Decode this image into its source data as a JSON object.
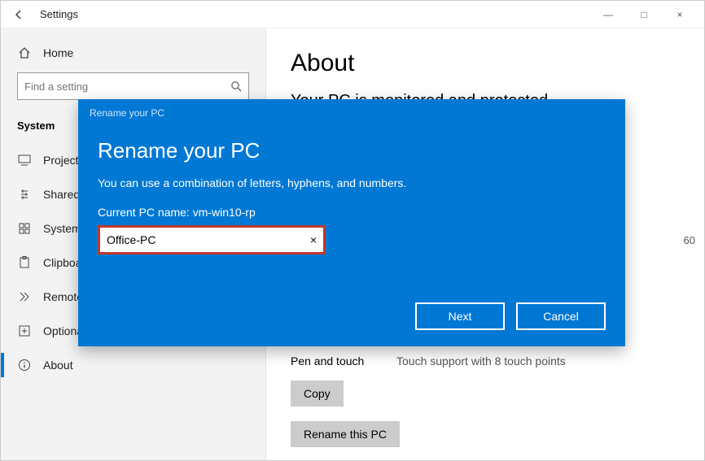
{
  "titlebar": {
    "back_arrow": "←",
    "title": "Settings",
    "minimize": "—",
    "maximize": "□",
    "close": "×"
  },
  "sidebar": {
    "home_label": "Home",
    "search_placeholder": "Find a setting",
    "system_header": "System",
    "items": [
      {
        "label": "Projecting to this PC"
      },
      {
        "label": "Shared experiences"
      },
      {
        "label": "System components"
      },
      {
        "label": "Clipboard"
      },
      {
        "label": "Remote Desktop"
      },
      {
        "label": "Optional features"
      },
      {
        "label": "About"
      }
    ]
  },
  "content": {
    "heading": "About",
    "protected_line": "Your PC is monitored and protected.",
    "pen_label": "Pen and touch",
    "pen_value": "Touch support with 8 touch points",
    "copy_btn": "Copy",
    "rename_btn": "Rename this PC",
    "partial_right": "60"
  },
  "modal": {
    "small_title": "Rename your PC",
    "heading": "Rename your PC",
    "description": "You can use a combination of letters, hyphens, and numbers.",
    "current_label": "Current PC name: vm-win10-rp",
    "input_value": "Office-PC",
    "clear_x": "×",
    "next": "Next",
    "cancel": "Cancel"
  }
}
